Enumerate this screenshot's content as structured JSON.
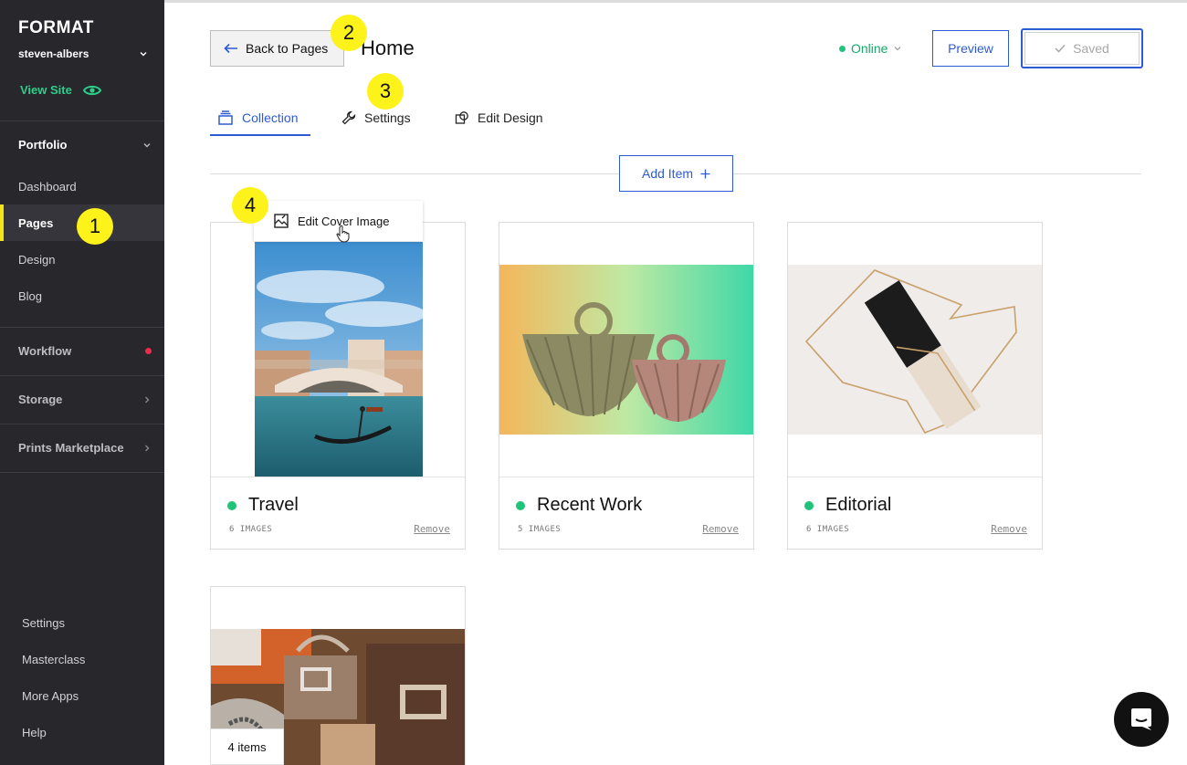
{
  "sidebar": {
    "logo": "FORMAT",
    "account": "steven-albers",
    "view_site": "View Site",
    "sections": {
      "portfolio": "Portfolio",
      "workflow": "Workflow",
      "storage": "Storage",
      "prints": "Prints Marketplace"
    },
    "items": [
      {
        "label": "Dashboard"
      },
      {
        "label": "Pages",
        "active": true
      },
      {
        "label": "Design"
      },
      {
        "label": "Blog"
      }
    ],
    "bottom": [
      {
        "label": "Settings"
      },
      {
        "label": "Masterclass"
      },
      {
        "label": "More Apps"
      },
      {
        "label": "Help"
      }
    ]
  },
  "badges": [
    "1",
    "2",
    "3",
    "4"
  ],
  "header": {
    "back_label": "Back to Pages",
    "title": "Home",
    "status": "Online",
    "preview": "Preview",
    "saved": "Saved"
  },
  "tabs": [
    {
      "label": "Collection",
      "active": true
    },
    {
      "label": "Settings"
    },
    {
      "label": "Edit Design"
    }
  ],
  "add_item": "Add Item",
  "tooltip": "Edit Cover Image",
  "cards": [
    {
      "name": "Travel",
      "count": "6 IMAGES",
      "remove": "Remove"
    },
    {
      "name": "Recent Work",
      "count": "5 IMAGES",
      "remove": "Remove"
    },
    {
      "name": "Editorial",
      "count": "6 IMAGES",
      "remove": "Remove"
    }
  ],
  "items_tag": "4 items",
  "colors": {
    "accent": "#2e5bd1",
    "online": "#21c37b",
    "sidebar_bg": "#27272c",
    "badge": "#fdf21a",
    "view_site": "#2ad08a"
  }
}
